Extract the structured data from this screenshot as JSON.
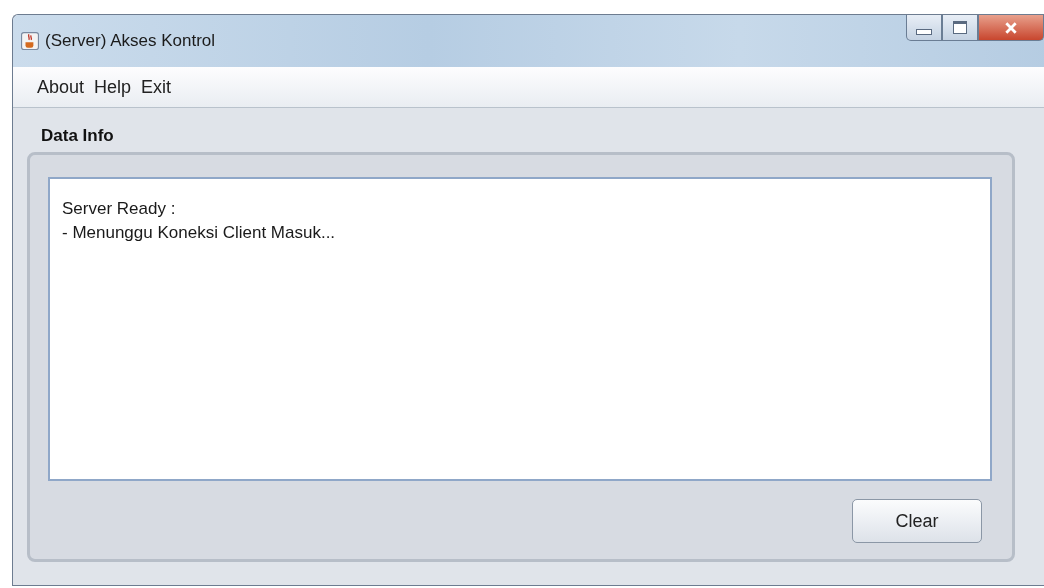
{
  "window": {
    "title": "(Server) Akses Kontrol"
  },
  "menu": [
    "About",
    "Help",
    "Exit"
  ],
  "panel": {
    "title": "Data Info",
    "log": [
      "Server Ready :",
      "- Menunggu Koneksi Client Masuk..."
    ],
    "button": "Clear"
  }
}
